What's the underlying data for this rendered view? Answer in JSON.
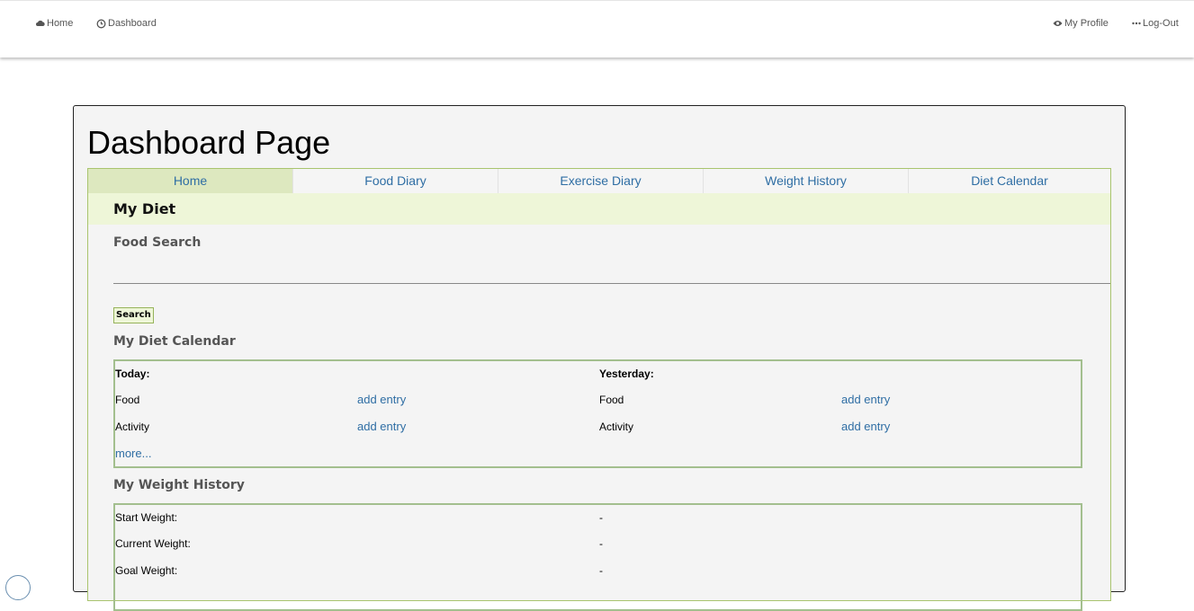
{
  "nav": {
    "home": {
      "label": "Home",
      "icon": "cloud-icon"
    },
    "dashboard": {
      "label": "Dashboard",
      "icon": "clock-icon"
    },
    "profile": {
      "label": "My Profile",
      "icon": "eye-icon"
    },
    "logout": {
      "label": "Log-Out",
      "icon": "ellipsis-icon"
    }
  },
  "page_title": "Dashboard Page",
  "tabs": [
    {
      "label": "Home",
      "active": true
    },
    {
      "label": "Food Diary"
    },
    {
      "label": "Exercise Diary"
    },
    {
      "label": "Weight History"
    },
    {
      "label": "Diet Calendar"
    }
  ],
  "diet_header": "My Diet",
  "food_search": {
    "title": "Food Search",
    "value": "",
    "button": "Search"
  },
  "calendar": {
    "title": "My Diet Calendar",
    "today_label": "Today:",
    "yesterday_label": "Yesterday:",
    "food_label": "Food",
    "activity_label": "Activity",
    "add_entry": "add entry",
    "more": "more..."
  },
  "weight": {
    "title": "My Weight History",
    "start_label": "Start Weight:",
    "current_label": "Current Weight:",
    "goal_label": "Goal Weight:",
    "start_value": "-",
    "current_value": "-",
    "goal_value": "-"
  },
  "colors": {
    "link": "#2f6ea4",
    "border_green": "#a9c46e",
    "active_tab": "#dde8bf",
    "header_band": "#eef6d8"
  }
}
